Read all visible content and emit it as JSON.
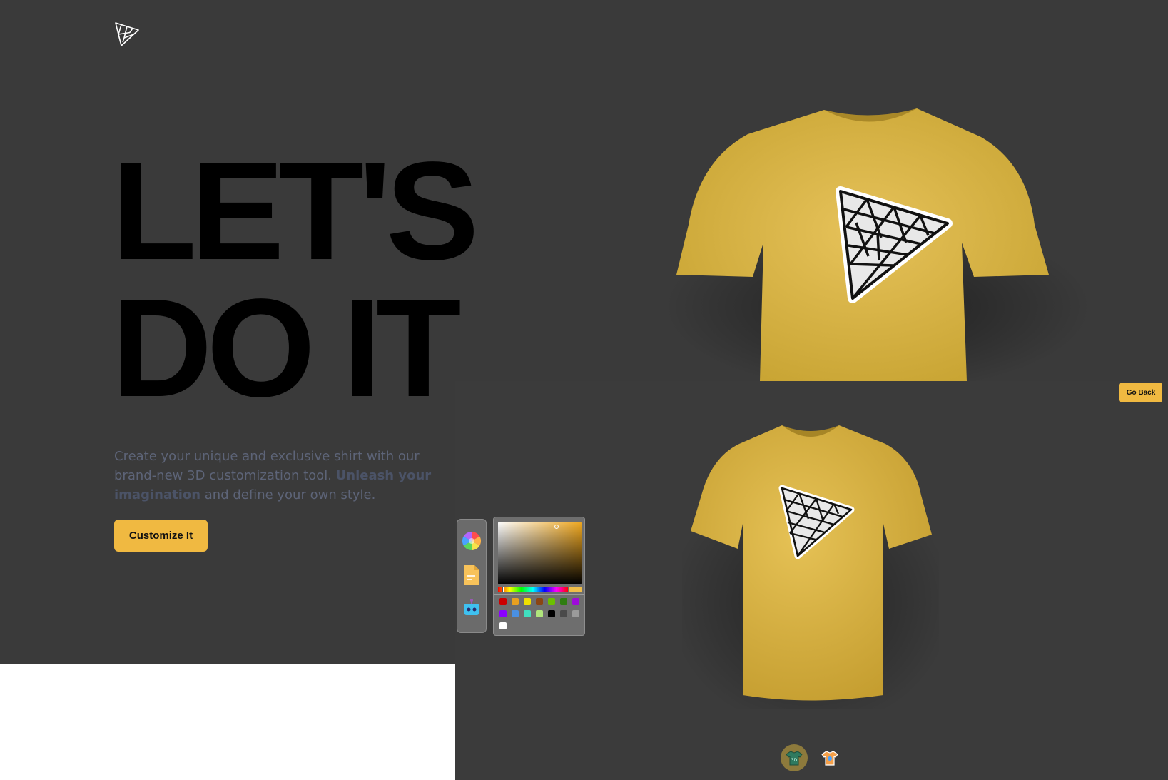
{
  "landing": {
    "logo_icon": "threejs-triangle-logo",
    "headline_line1": "LET'S",
    "headline_line2": "DO IT",
    "intro_part1": "Create your unique and exclusive shirt with our brand-new 3D customization tool. ",
    "intro_strong": "Unleash your imagination",
    "intro_part2": " and define your own style.",
    "cta_label": "Customize It"
  },
  "customizer": {
    "go_back_label": "Go Back",
    "editor_tabs": [
      {
        "name": "colorpicker",
        "icon": "color-wheel-icon"
      },
      {
        "name": "filepicker",
        "icon": "file-icon"
      },
      {
        "name": "aipicker",
        "icon": "ai-robot-icon"
      }
    ],
    "color_picker": {
      "current_color": "#EFBD48",
      "presets": [
        "#CC0000",
        "#E8A020",
        "#F0E000",
        "#8B4513",
        "#6BBF00",
        "#2E7D10",
        "#9E0AD8",
        "#8A00FF",
        "#4A90E2",
        "#40E0C0",
        "#B0E57C",
        "#000000",
        "#4A4A4A",
        "#9B9B9B",
        "#FFFFFF"
      ]
    },
    "filter_tabs": [
      {
        "name": "logoShirt",
        "icon": "logo-shirt-icon",
        "active": true
      },
      {
        "name": "stylishShirt",
        "icon": "stylish-shirt-icon",
        "active": false
      }
    ]
  },
  "colors": {
    "accent": "#F0B941",
    "shirt": "#E2B844",
    "background": "#3A3A3A"
  }
}
